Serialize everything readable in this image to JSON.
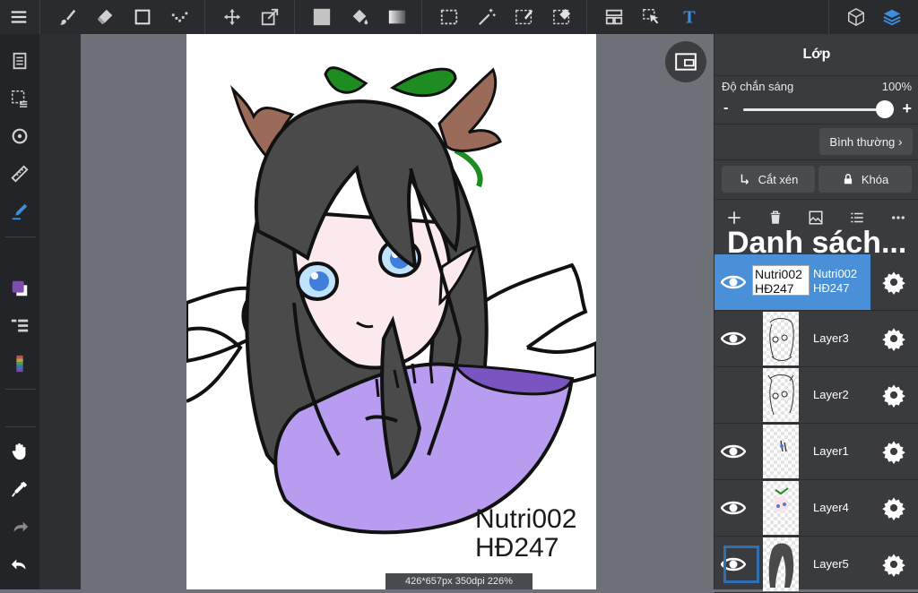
{
  "toolbar": {
    "icons": [
      "menu-icon",
      "brush-icon",
      "eraser-icon",
      "shape-icon",
      "dots-icon",
      "move-icon",
      "transform-icon",
      "fill-color-icon",
      "bucket-icon",
      "gradient-icon",
      "select-rect-icon",
      "magic-wand-icon",
      "select-pen-icon",
      "select-eraser-icon",
      "layout-icon",
      "select-move-icon",
      "text-icon",
      "3d-icon",
      "layers-icon"
    ]
  },
  "canvas": {
    "signature_line1": "Nutri002",
    "signature_line2": "HĐ247",
    "status": "426*657px 350dpi 226%"
  },
  "panel": {
    "title": "Lớp",
    "opacity_label": "Độ chắn sáng",
    "opacity_value": "100%",
    "opacity_level": 1.0,
    "minus": "-",
    "plus": "+",
    "blend_mode": "Bình thường",
    "clip_label": "Cắt xén",
    "lock_label": "Khóa",
    "list_header": "Danh sách...",
    "layers": [
      {
        "name_line1": "Nutri002",
        "name_line2": "HĐ247",
        "thumb_line1": "Nutri002",
        "thumb_line2": "HĐ247",
        "visible": true,
        "selected": true
      },
      {
        "name": "Layer3",
        "visible": true
      },
      {
        "name": "Layer2",
        "visible": false
      },
      {
        "name": "Layer1",
        "visible": true
      },
      {
        "name": "Layer4",
        "visible": true
      },
      {
        "name": "Layer5",
        "visible": true
      }
    ]
  },
  "colors": {
    "primary": "#7a4fb0",
    "accent": "#4a90d9",
    "layers_icon": "#3a8ee0",
    "text_tool": "#3a8ee0"
  }
}
